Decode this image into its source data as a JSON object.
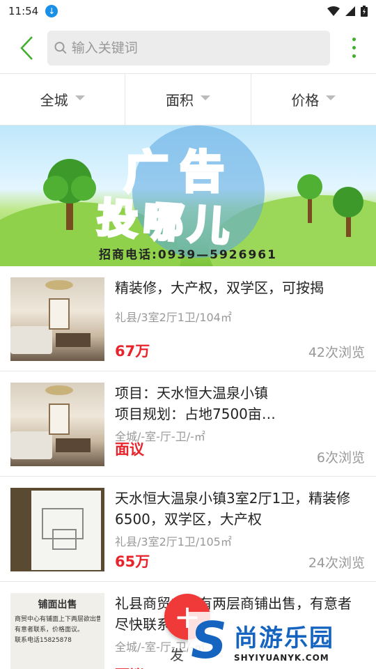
{
  "status": {
    "time": "11:54"
  },
  "search": {
    "placeholder": "输入关键词"
  },
  "filters": [
    "全城",
    "面积",
    "价格"
  ],
  "banner": {
    "title_line1": "广告",
    "title_line2": "投哪儿",
    "phone": "招商电话:0939—5926961"
  },
  "listings": [
    {
      "title": "精装修，大产权，双学区，可按揭",
      "sub": "礼县/3室2厅1卫/104㎡",
      "price": "67万",
      "views": "42次浏览"
    },
    {
      "title": "项目：天水恒大温泉小镇\n项目规划：占地7500亩…",
      "sub": "全城/-室-厅-卫/-㎡",
      "price": "面议",
      "views": "6次浏览"
    },
    {
      "title": "天水恒大温泉小镇3室2厅1卫，精装修6500，双学区，大产权",
      "sub": "礼县/3室2厅1卫/105㎡",
      "price": "65万",
      "views": "24次浏览"
    },
    {
      "title": "礼县商贸中心有两层商铺出售，有意者尽快联系",
      "sub": "全城/-室-厅-卫/-㎡",
      "price": "面议",
      "views": ""
    }
  ],
  "thumb4_text": {
    "heading": "铺面出售",
    "line1": "商贸中心有铺面上下两层欲出售",
    "line2": "有意者联系，价格面议。",
    "line3": "联系电话15825878"
  },
  "fab": {
    "label": "发"
  },
  "watermark": {
    "cn": "尚游乐园",
    "en": "SHYIYUANYK.COM"
  },
  "colors": {
    "accent_green": "#3fae2a",
    "price_red": "#e8232b",
    "fab_red": "#f03a3a"
  }
}
